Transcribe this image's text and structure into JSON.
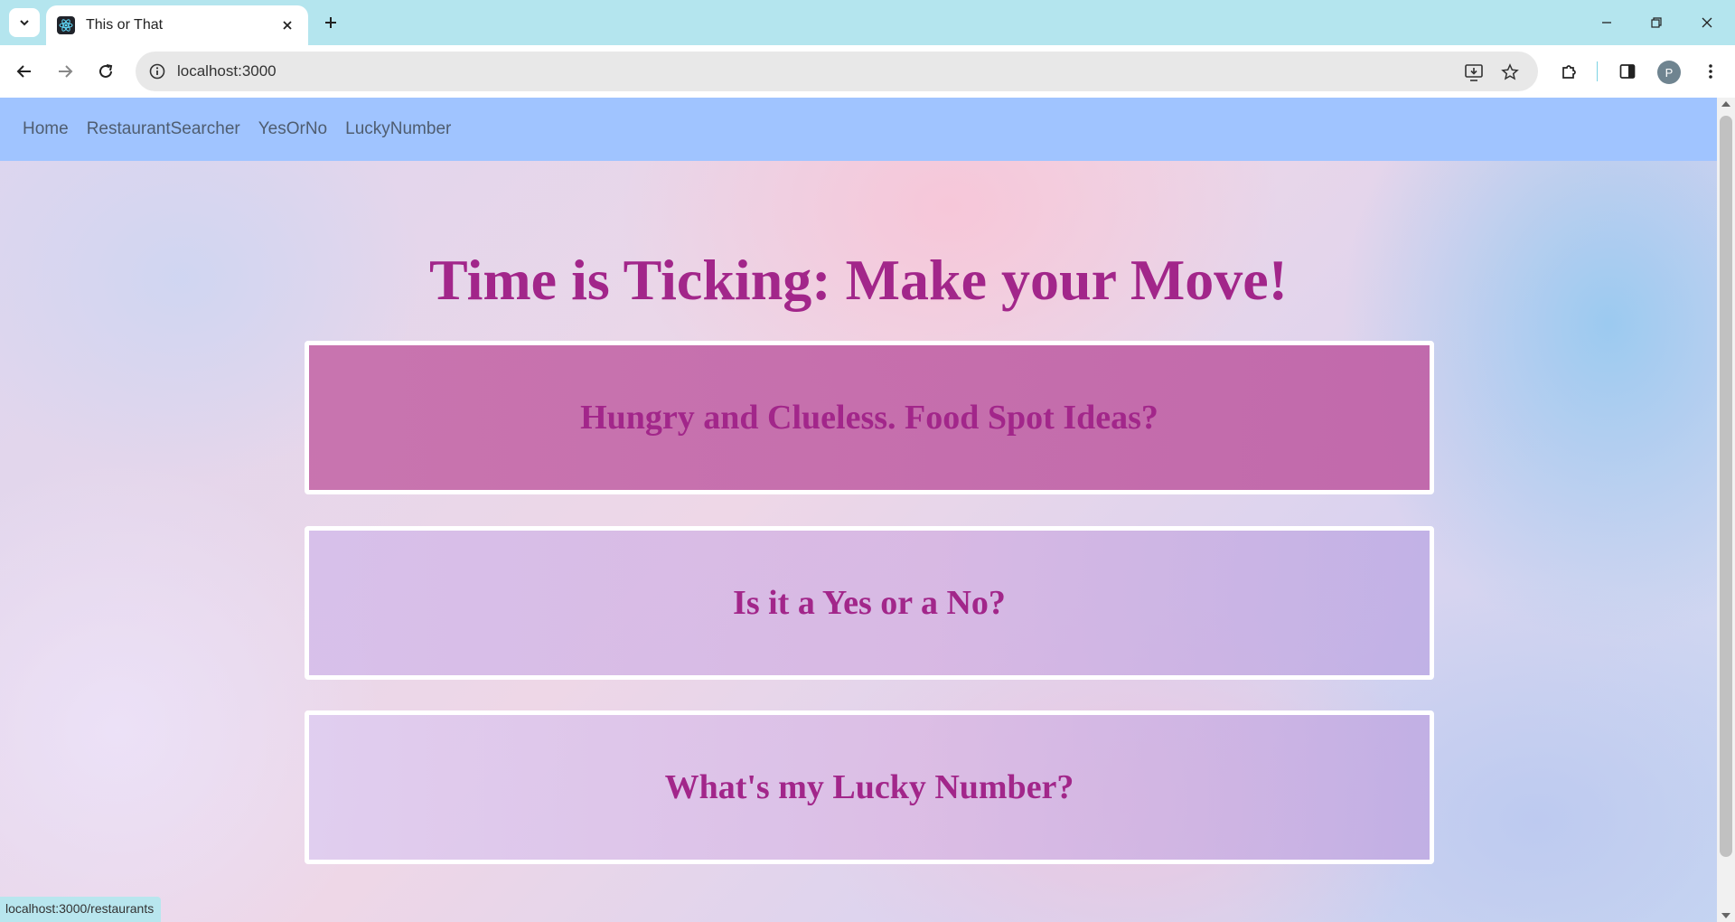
{
  "browser": {
    "tab": {
      "title": "This or That"
    },
    "address": {
      "url": "localhost:3000"
    },
    "profile_initial": "P",
    "status_url": "localhost:3000/restaurants"
  },
  "nav": {
    "links": [
      "Home",
      "RestaurantSearcher",
      "YesOrNo",
      "LuckyNumber"
    ]
  },
  "main": {
    "title": "Time is Ticking: Make your Move!",
    "cards": [
      "Hungry and Clueless. Food Spot Ideas?",
      "Is it a Yes or a No?",
      "What's my Lucky Number?"
    ]
  },
  "colors": {
    "navbar": "#a0c4ff",
    "accent_text": "#a2268a"
  }
}
